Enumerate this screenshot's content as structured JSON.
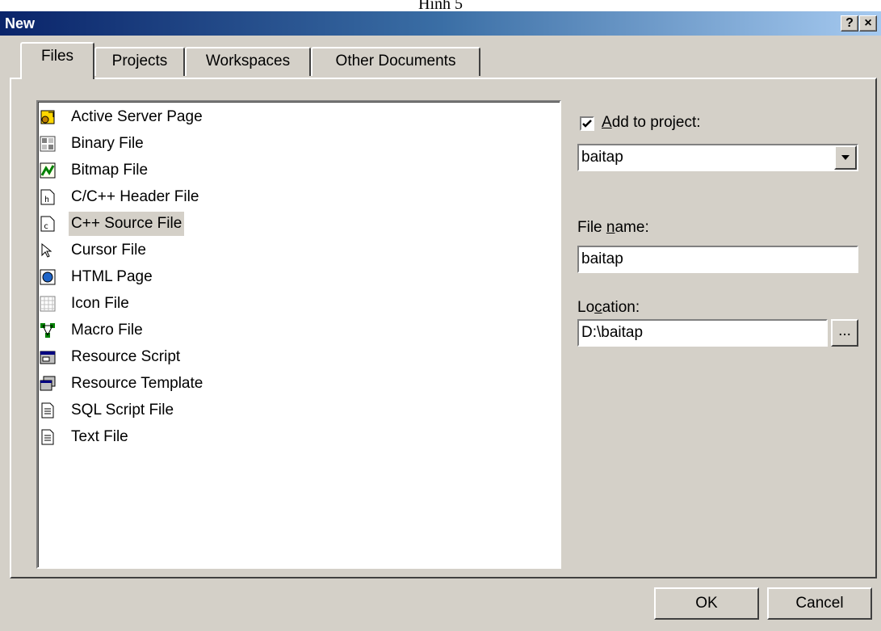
{
  "document_caption": "Hình 5",
  "window": {
    "title": "New",
    "help_glyph": "?",
    "close_glyph": "×"
  },
  "tabs": [
    {
      "label": "Files",
      "active": true
    },
    {
      "label": "Projects",
      "active": false
    },
    {
      "label": "Workspaces",
      "active": false
    },
    {
      "label": "Other Documents",
      "active": false
    }
  ],
  "file_types": [
    {
      "label": "Active Server Page",
      "icon": "asp-icon"
    },
    {
      "label": "Binary File",
      "icon": "binary-file-icon"
    },
    {
      "label": "Bitmap File",
      "icon": "bitmap-icon"
    },
    {
      "label": "C/C++ Header File",
      "icon": "header-file-icon"
    },
    {
      "label": "C++ Source File",
      "icon": "source-file-icon",
      "selected": true
    },
    {
      "label": "Cursor File",
      "icon": "cursor-icon"
    },
    {
      "label": "HTML Page",
      "icon": "html-page-icon"
    },
    {
      "label": "Icon File",
      "icon": "icon-file-icon"
    },
    {
      "label": "Macro File",
      "icon": "macro-icon"
    },
    {
      "label": "Resource Script",
      "icon": "resource-script-icon"
    },
    {
      "label": "Resource Template",
      "icon": "resource-template-icon"
    },
    {
      "label": "SQL Script File",
      "icon": "document-icon"
    },
    {
      "label": "Text File",
      "icon": "document-icon"
    }
  ],
  "add_to_project": {
    "checked": true,
    "label_prefix": "",
    "accel": "A",
    "label_rest": "dd to project:",
    "value": "baitap"
  },
  "file_name": {
    "label_prefix": "File ",
    "accel": "n",
    "label_rest": "ame:",
    "value": "baitap"
  },
  "location": {
    "label_prefix": "Lo",
    "accel": "c",
    "label_rest": "ation:",
    "value": "D:\\baitap",
    "browse_label": "..."
  },
  "buttons": {
    "ok": "OK",
    "cancel": "Cancel"
  },
  "colors": {
    "dialog_bg": "#d4d0c8",
    "title_start": "#0a246a",
    "title_end": "#a6caf0"
  }
}
